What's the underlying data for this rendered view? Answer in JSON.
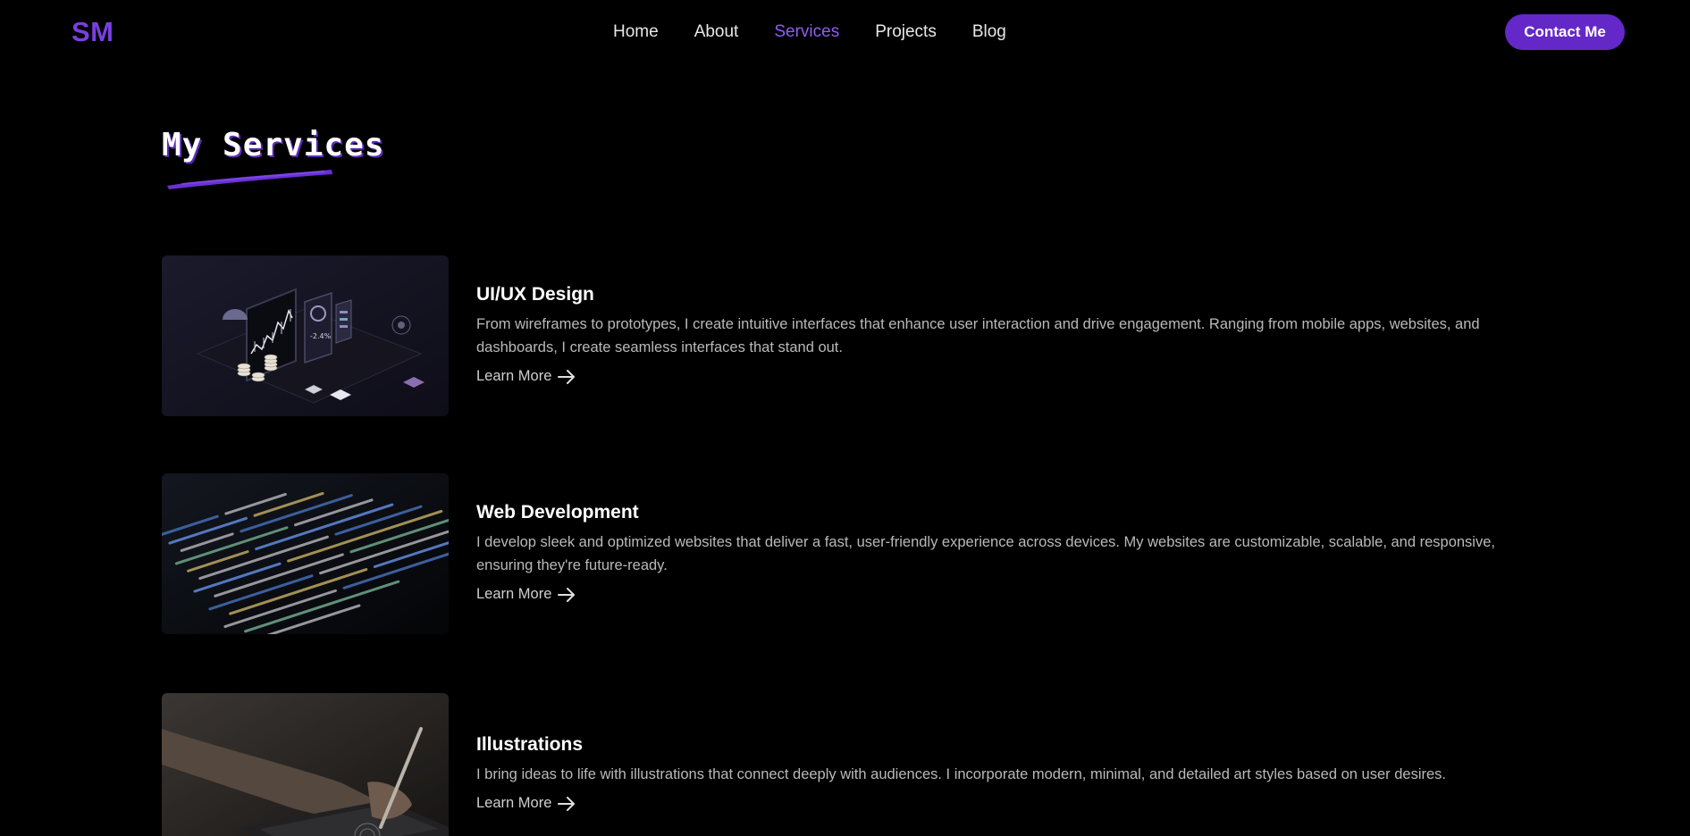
{
  "brand": {
    "logo": "SM"
  },
  "nav": {
    "items": [
      {
        "label": "Home",
        "active": false
      },
      {
        "label": "About",
        "active": false
      },
      {
        "label": "Services",
        "active": true
      },
      {
        "label": "Projects",
        "active": false
      },
      {
        "label": "Blog",
        "active": false
      }
    ],
    "contact_label": "Contact Me"
  },
  "colors": {
    "accent": "#6428c9",
    "accent_light": "#8d5ef2",
    "background": "#000000"
  },
  "section": {
    "title": "My Services"
  },
  "services": [
    {
      "title": "UI/UX Design",
      "description": "From wireframes to prototypes, I create intuitive interfaces that enhance user interaction and drive engagement. Ranging from mobile apps, websites, and dashboards, I create seamless interfaces that stand out.",
      "link_label": "Learn More",
      "image": "isometric-dashboard-illustration",
      "image_text": "-2.4%"
    },
    {
      "title": "Web Development",
      "description": "I develop sleek and optimized websites that deliver a fast, user-friendly experience across devices. My websites are customizable, scalable, and responsive, ensuring they're future-ready.",
      "link_label": "Learn More",
      "image": "code-on-screen-photo"
    },
    {
      "title": "Illustrations",
      "description": "I bring ideas to life with illustrations that connect deeply with audiences. I incorporate modern, minimal, and detailed art styles based on user desires.",
      "link_label": "Learn More",
      "image": "hand-drawing-on-tablet-photo"
    }
  ]
}
